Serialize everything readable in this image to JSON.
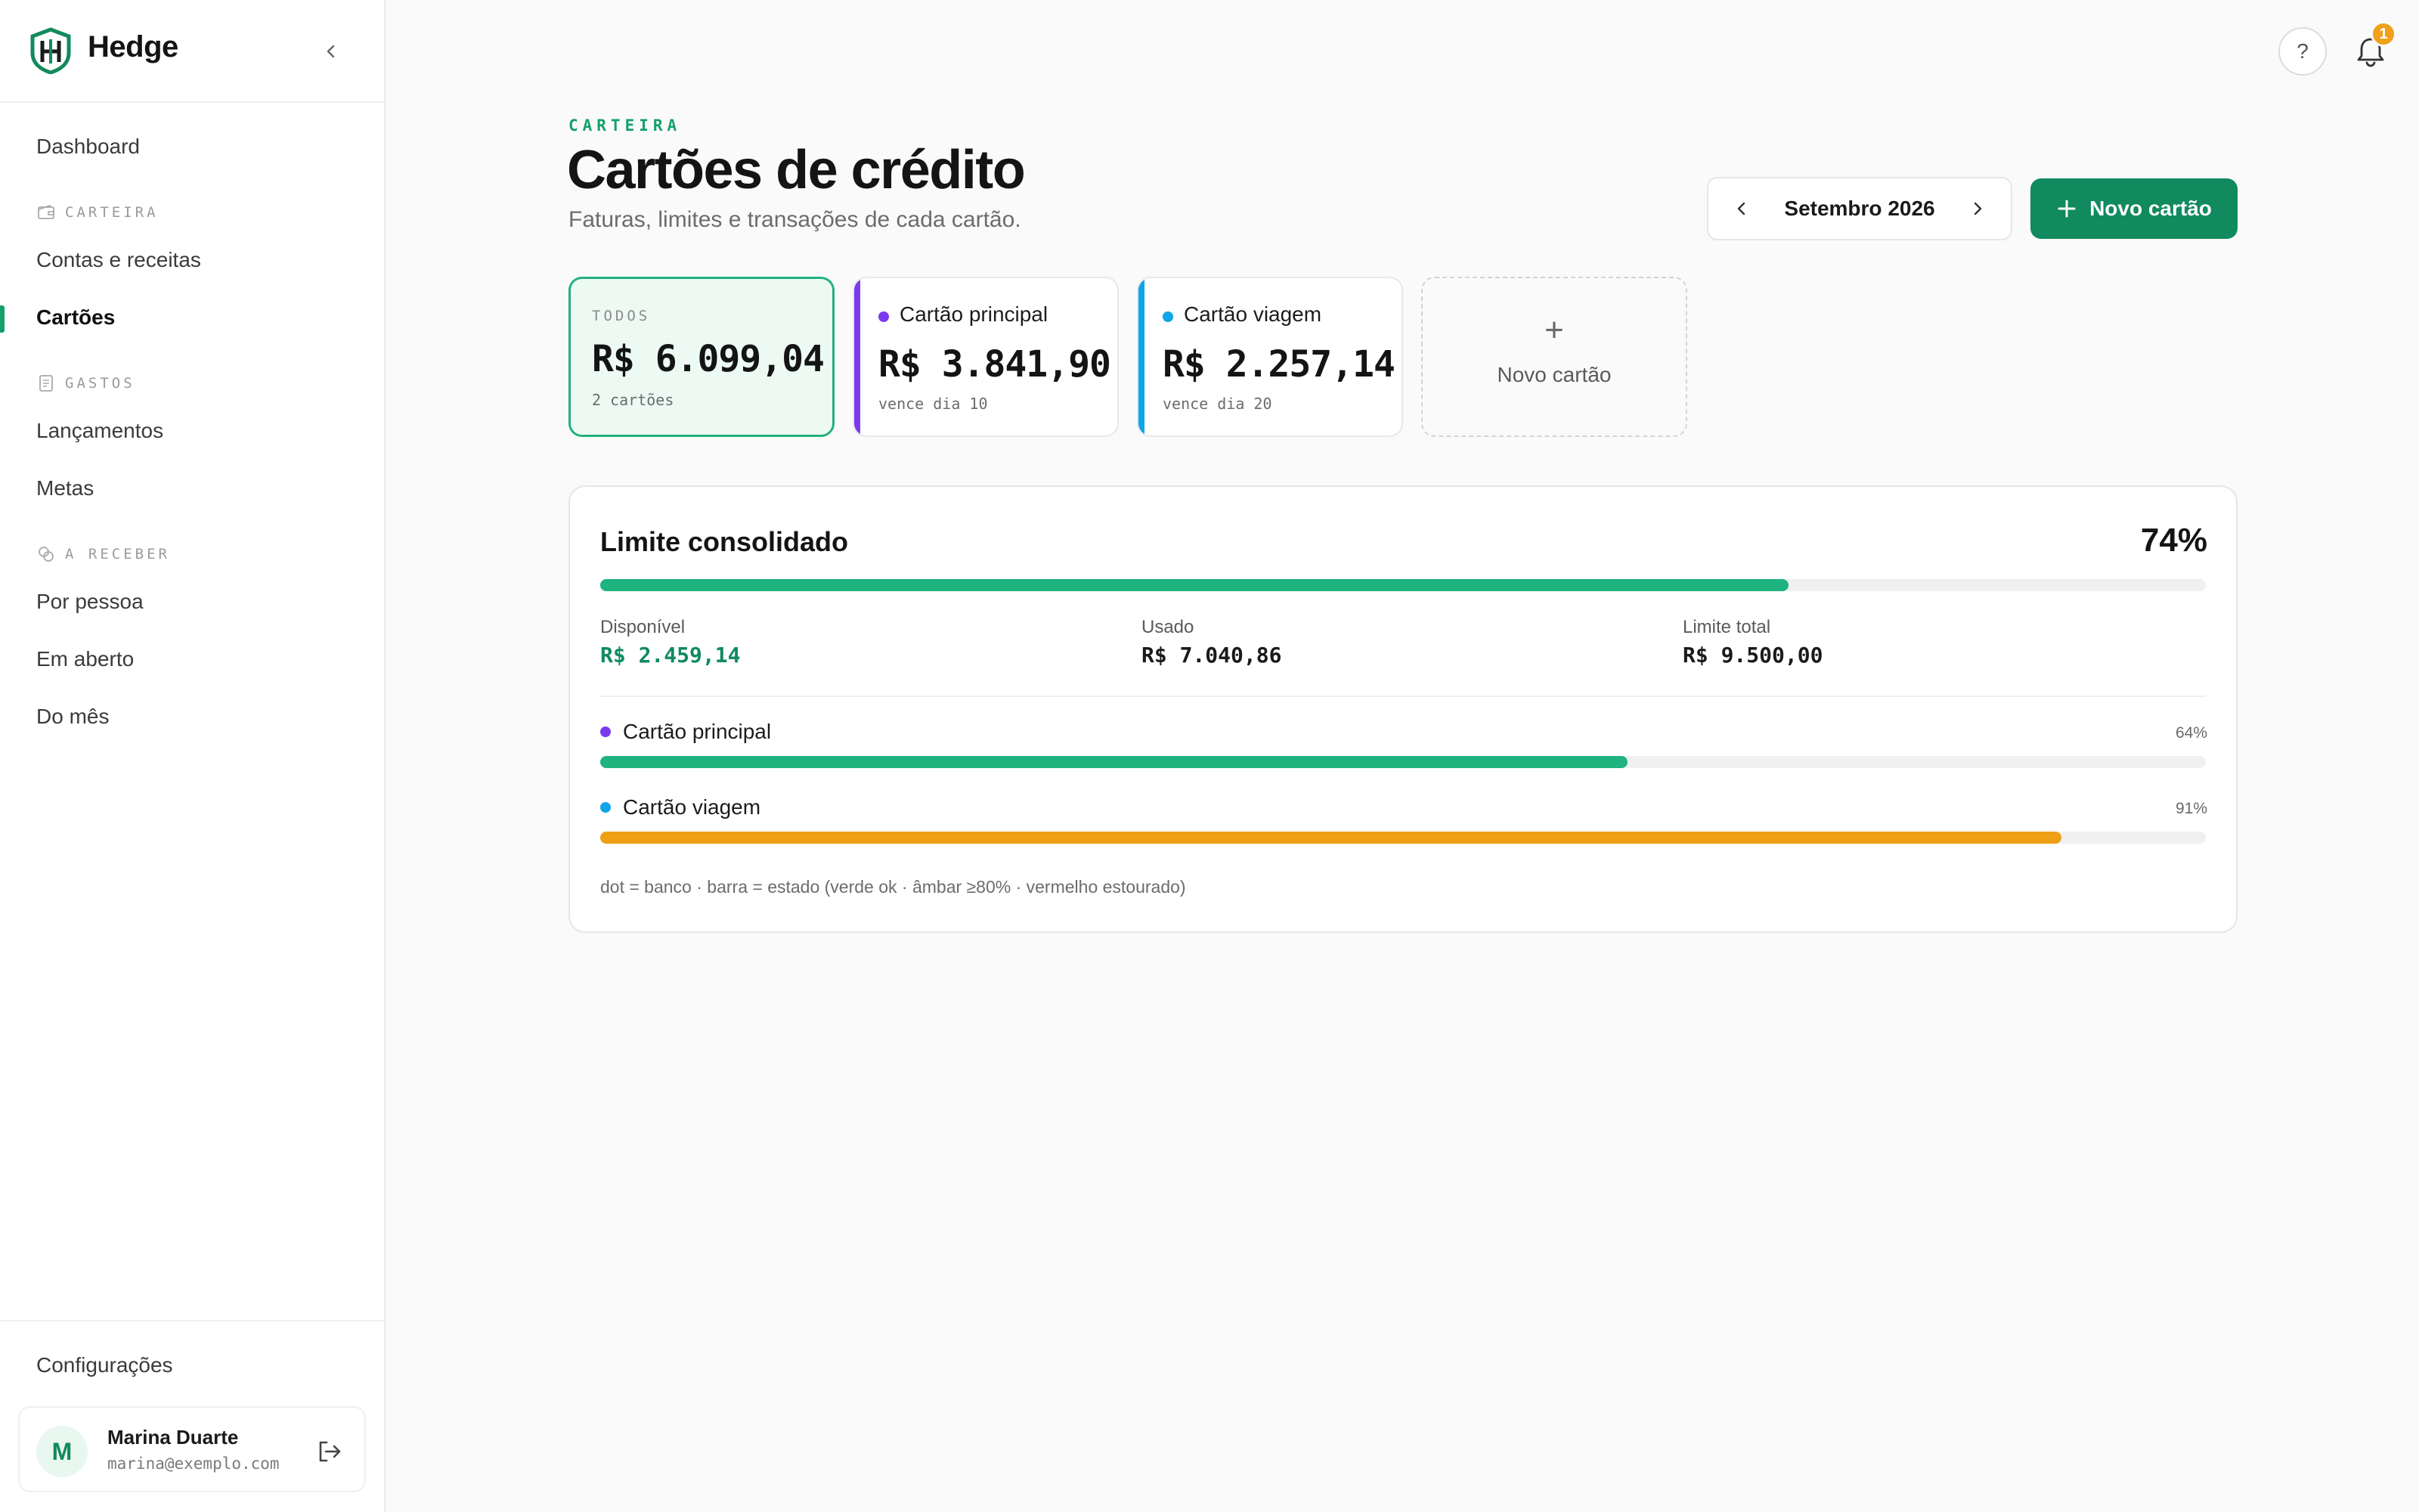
{
  "brand": {
    "name": "Hedge"
  },
  "sidebar": {
    "dashboard": "Dashboard",
    "sections": [
      {
        "label": "CARTEIRA",
        "items": [
          "Contas e receitas",
          "Cartões"
        ]
      },
      {
        "label": "GASTOS",
        "items": [
          "Lançamentos",
          "Metas"
        ]
      },
      {
        "label": "A RECEBER",
        "items": [
          "Por pessoa",
          "Em aberto",
          "Do mês"
        ]
      }
    ],
    "active_item": "Cartões",
    "settings": "Configurações",
    "user": {
      "initial": "M",
      "name": "Marina Duarte",
      "email": "marina@exemplo.com"
    }
  },
  "topbar": {
    "help": "?",
    "notifications_count": "1"
  },
  "header": {
    "eyebrow": "CARTEIRA",
    "title": "Cartões de crédito",
    "subtitle": "Faturas, limites e transações de cada cartão.",
    "month": "Setembro 2026",
    "new_card_button": "Novo cartão"
  },
  "cards": {
    "all": {
      "eyebrow": "TODOS",
      "amount": "R$ 6.099,04",
      "foot": "2 cartões"
    },
    "list": [
      {
        "name": "Cartão principal",
        "amount": "R$ 3.841,90",
        "foot": "vence dia 10",
        "color": "#7c3aed"
      },
      {
        "name": "Cartão viagem",
        "amount": "R$ 2.257,14",
        "foot": "vence dia 20",
        "color": "#0ea5e9"
      }
    ],
    "add_label": "Novo cartão"
  },
  "limits": {
    "title": "Limite consolidado",
    "percent": "74%",
    "percent_value": 74,
    "available_label": "Disponível",
    "available_value": "R$ 2.459,14",
    "used_label": "Usado",
    "used_value": "R$ 7.040,86",
    "total_label": "Limite total",
    "total_value": "R$ 9.500,00",
    "rows": [
      {
        "name": "Cartão principal",
        "percent": "64%",
        "percent_value": 64,
        "dot": "#7c3aed",
        "bar": "#1eb37f"
      },
      {
        "name": "Cartão viagem",
        "percent": "91%",
        "percent_value": 91,
        "dot": "#0ea5e9",
        "bar": "#ef9f14"
      }
    ],
    "note": "dot = banco · barra = estado (verde ok · âmbar ≥80% · vermelho estourado)"
  },
  "colors": {
    "accent": "#108a5e",
    "accent_light": "#ecfaf3",
    "amber": "#ef9f14"
  }
}
